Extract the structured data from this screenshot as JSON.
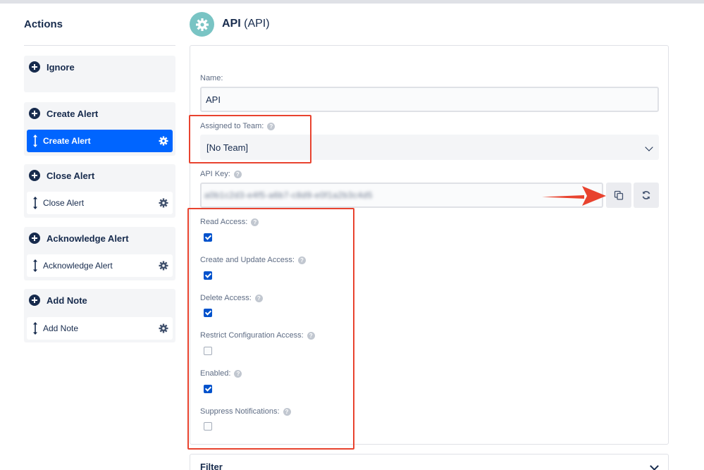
{
  "sidebar": {
    "title": "Actions",
    "groups": [
      {
        "label": "Ignore",
        "items": []
      },
      {
        "label": "Create Alert",
        "items": [
          {
            "label": "Create Alert",
            "active": true
          }
        ]
      },
      {
        "label": "Close Alert",
        "items": [
          {
            "label": "Close Alert",
            "active": false
          }
        ]
      },
      {
        "label": "Acknowledge Alert",
        "items": [
          {
            "label": "Acknowledge Alert",
            "active": false
          }
        ]
      },
      {
        "label": "Add Note",
        "items": [
          {
            "label": "Add Note",
            "active": false
          }
        ]
      }
    ]
  },
  "header": {
    "title_bold": "API",
    "title_suffix": "(API)",
    "icon": "gear-icon"
  },
  "form": {
    "name_label": "Name:",
    "name_value": "API",
    "team_label": "Assigned to Team:",
    "team_value": "[No Team]",
    "apikey_label": "API Key:",
    "apikey_value": "a0b1c2d3-e4f5-a6b7-c8d9-e0f1a2b3c4d5",
    "copy_icon": "copy-icon",
    "refresh_icon": "refresh-icon",
    "checkboxes": [
      {
        "label": "Read Access:",
        "checked": true
      },
      {
        "label": "Create and Update Access:",
        "checked": true
      },
      {
        "label": "Delete Access:",
        "checked": true
      },
      {
        "label": "Restrict Configuration Access:",
        "checked": false
      },
      {
        "label": "Enabled:",
        "checked": true
      },
      {
        "label": "Suppress Notifications:",
        "checked": false
      }
    ]
  },
  "filter": {
    "title": "Filter"
  },
  "colors": {
    "accent": "#0065ff",
    "checkbox": "#0052cc",
    "annotation": "#e8432f",
    "header_icon": "#79c4c4"
  }
}
